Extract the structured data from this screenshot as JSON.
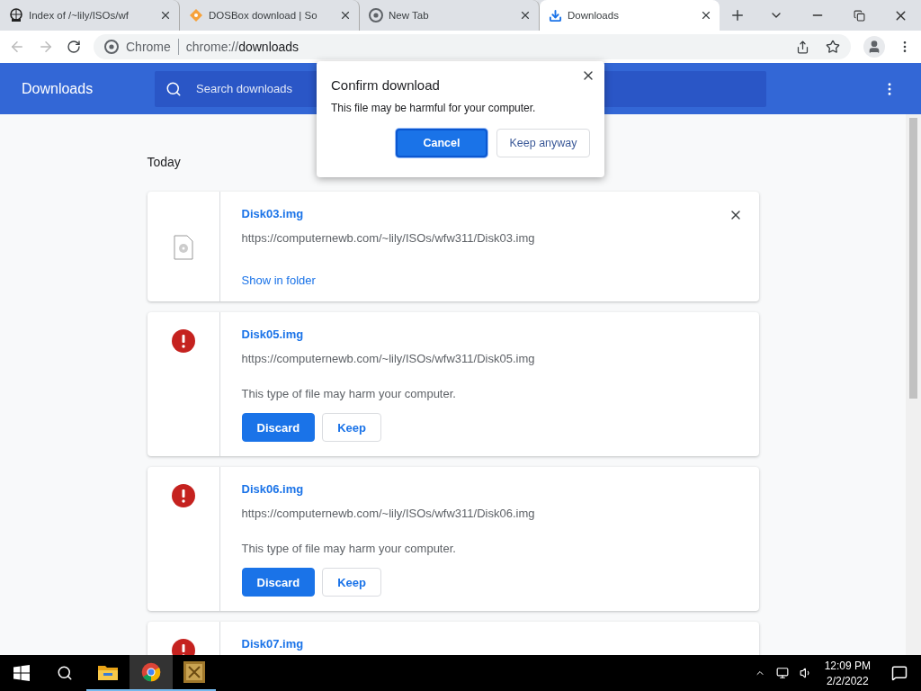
{
  "tabs": [
    {
      "title": "Index of /~lily/ISOs/wf",
      "selected": false
    },
    {
      "title": "DOSBox download | So",
      "selected": false
    },
    {
      "title": "New Tab",
      "selected": false
    },
    {
      "title": "Downloads",
      "selected": true
    }
  ],
  "address": {
    "site_label": "Chrome",
    "url_scheme": "chrome://",
    "url_host": "downloads"
  },
  "header": {
    "title": "Downloads",
    "search_placeholder": "Search downloads"
  },
  "section": "Today",
  "downloads": [
    {
      "kind": "complete",
      "name": "Disk03.img",
      "url": "https://computernewb.com/~lily/ISOs/wfw311/Disk03.img",
      "link": "Show in folder"
    },
    {
      "kind": "dangerous",
      "name": "Disk05.img",
      "url": "https://computernewb.com/~lily/ISOs/wfw311/Disk05.img",
      "warning": "This type of file may harm your computer.",
      "buttons": [
        "Discard",
        "Keep"
      ]
    },
    {
      "kind": "dangerous",
      "name": "Disk06.img",
      "url": "https://computernewb.com/~lily/ISOs/wfw311/Disk06.img",
      "warning": "This type of file may harm your computer.",
      "buttons": [
        "Discard",
        "Keep"
      ]
    },
    {
      "kind": "dangerous",
      "name": "Disk07.img"
    }
  ],
  "dialog": {
    "title": "Confirm download",
    "message": "This file may be harmful for your computer.",
    "primary": "Cancel",
    "secondary": "Keep anyway"
  },
  "taskbar": {
    "time": "12:09 PM",
    "date": "2/2/2022"
  }
}
